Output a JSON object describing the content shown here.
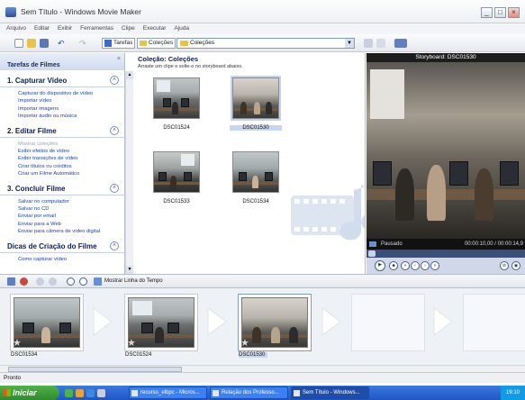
{
  "window": {
    "title": "Sem Título - Windows Movie Maker",
    "minimize": "_",
    "maximize": "□",
    "close": "×"
  },
  "menu": [
    "Arquivo",
    "Editar",
    "Exibir",
    "Ferramentas",
    "Clipe",
    "Executar",
    "Ajuda"
  ],
  "toolbar": {
    "tasks_label": "Tarefas",
    "collections_label": "Coleções",
    "collection_select_value": "Coleções"
  },
  "tasks_panel": {
    "title": "Tarefas de Filmes",
    "sections": [
      {
        "number": "1.",
        "title": "Capturar Vídeo",
        "items": [
          {
            "label": "Capturar do dispositivo de vídeo",
            "enabled": true
          },
          {
            "label": "Importar vídeo",
            "enabled": true
          },
          {
            "label": "Importar imagens",
            "enabled": true
          },
          {
            "label": "Importar áudio ou música",
            "enabled": true
          }
        ]
      },
      {
        "number": "2.",
        "title": "Editar Filme",
        "items": [
          {
            "label": "Mostrar coleções",
            "enabled": false
          },
          {
            "label": "Exibir efeitos de vídeo",
            "enabled": true
          },
          {
            "label": "Exibir transições de vídeo",
            "enabled": true
          },
          {
            "label": "Criar títulos ou créditos",
            "enabled": true
          },
          {
            "label": "Criar um Filme Automático",
            "enabled": true
          }
        ]
      },
      {
        "number": "3.",
        "title": "Concluir Filme",
        "items": [
          {
            "label": "Salvar no computador",
            "enabled": true
          },
          {
            "label": "Salvar no CD",
            "enabled": true
          },
          {
            "label": "Enviar por email",
            "enabled": true
          },
          {
            "label": "Enviar para a Web",
            "enabled": true
          },
          {
            "label": "Enviar para câmera de vídeo digital",
            "enabled": true
          }
        ]
      },
      {
        "number": "",
        "title": "Dicas de Criação do Filme",
        "items": [
          {
            "label": "Como capturar vídeo",
            "enabled": true
          }
        ]
      }
    ]
  },
  "collection": {
    "title": "Coleção: Coleções",
    "hint": "Arraste um clipe e solte-o no storyboard abaixo.",
    "clips": [
      {
        "name": "DSC01524",
        "selected": false
      },
      {
        "name": "DSC01530",
        "selected": true
      },
      {
        "name": "DSC01533",
        "selected": false
      },
      {
        "name": "DSC01534",
        "selected": false
      }
    ]
  },
  "preview": {
    "title": "Storyboard: DSC01530",
    "status": "Pausado",
    "time": "00:00:10,00 / 00:00:14,9"
  },
  "storyboard_toolbar": {
    "timeline_label": "Mostrar Linha do Tempo"
  },
  "storyboard": {
    "items": [
      {
        "name": "DSC01534",
        "selected": false
      },
      {
        "name": "DSC01524",
        "selected": false
      },
      {
        "name": "DSC01530",
        "selected": true
      }
    ]
  },
  "statusbar": {
    "text": "Pronto"
  },
  "taskbar": {
    "start_label": "Iniciar",
    "tasks": [
      {
        "label": "recurso_elbpc - Micros...",
        "active": false
      },
      {
        "label": "Relação dos Professo...",
        "active": false
      },
      {
        "label": "Sem Título - Windows...",
        "active": true
      }
    ],
    "clock": "19:10"
  },
  "colors": {
    "link": "#1d3fb0",
    "heading": "#0b1e55",
    "taskbar": "#2156c4",
    "start": "#2f8a2c"
  }
}
